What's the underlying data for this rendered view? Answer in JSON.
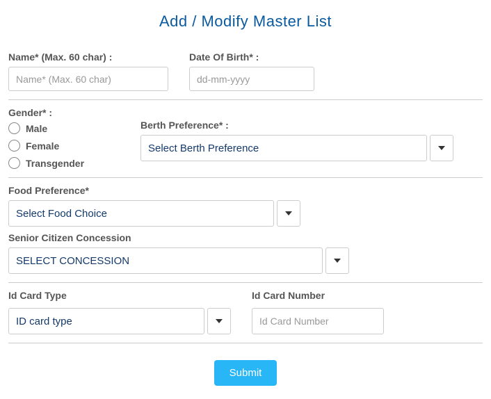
{
  "title": "Add / Modify Master List",
  "name": {
    "label": "Name* (Max. 60 char) :",
    "placeholder": "Name* (Max. 60 char)"
  },
  "dob": {
    "label": "Date Of Birth* :",
    "placeholder": "dd-mm-yyyy"
  },
  "gender": {
    "label": "Gender* :",
    "options": [
      "Male",
      "Female",
      "Transgender"
    ]
  },
  "berth": {
    "label": "Berth Preference* :",
    "selected": "Select Berth Preference"
  },
  "food": {
    "label": "Food Preference*",
    "selected": "Select Food Choice"
  },
  "concession": {
    "label": "Senior Citizen Concession",
    "selected": "SELECT CONCESSION"
  },
  "idType": {
    "label": "Id Card Type",
    "selected": "ID card type"
  },
  "idNumber": {
    "label": "Id Card Number",
    "placeholder": "Id Card Number"
  },
  "submit": "Submit"
}
